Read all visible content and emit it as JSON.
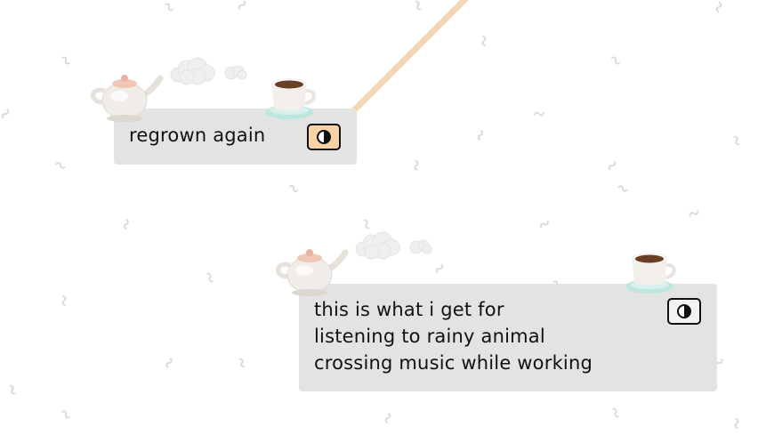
{
  "notes": [
    {
      "text": "regrown again",
      "toggle": "dark-mode-toggle",
      "toggle_state": "active"
    },
    {
      "text": "this is what i get for\nlistening to rainy animal\ncrossing music while working",
      "toggle": "dark-mode-toggle",
      "toggle_state": "idle"
    }
  ],
  "icons": [
    "teapot-icon",
    "steam-cloud-icon",
    "coffee-cup-icon",
    "contrast-icon"
  ],
  "colors": {
    "background": "#ffffff",
    "note_background": "#e3e3e3",
    "toggle_active": "#f7d3a6",
    "string": "#f3d6b2",
    "squiggle": "#dcdcdc"
  }
}
